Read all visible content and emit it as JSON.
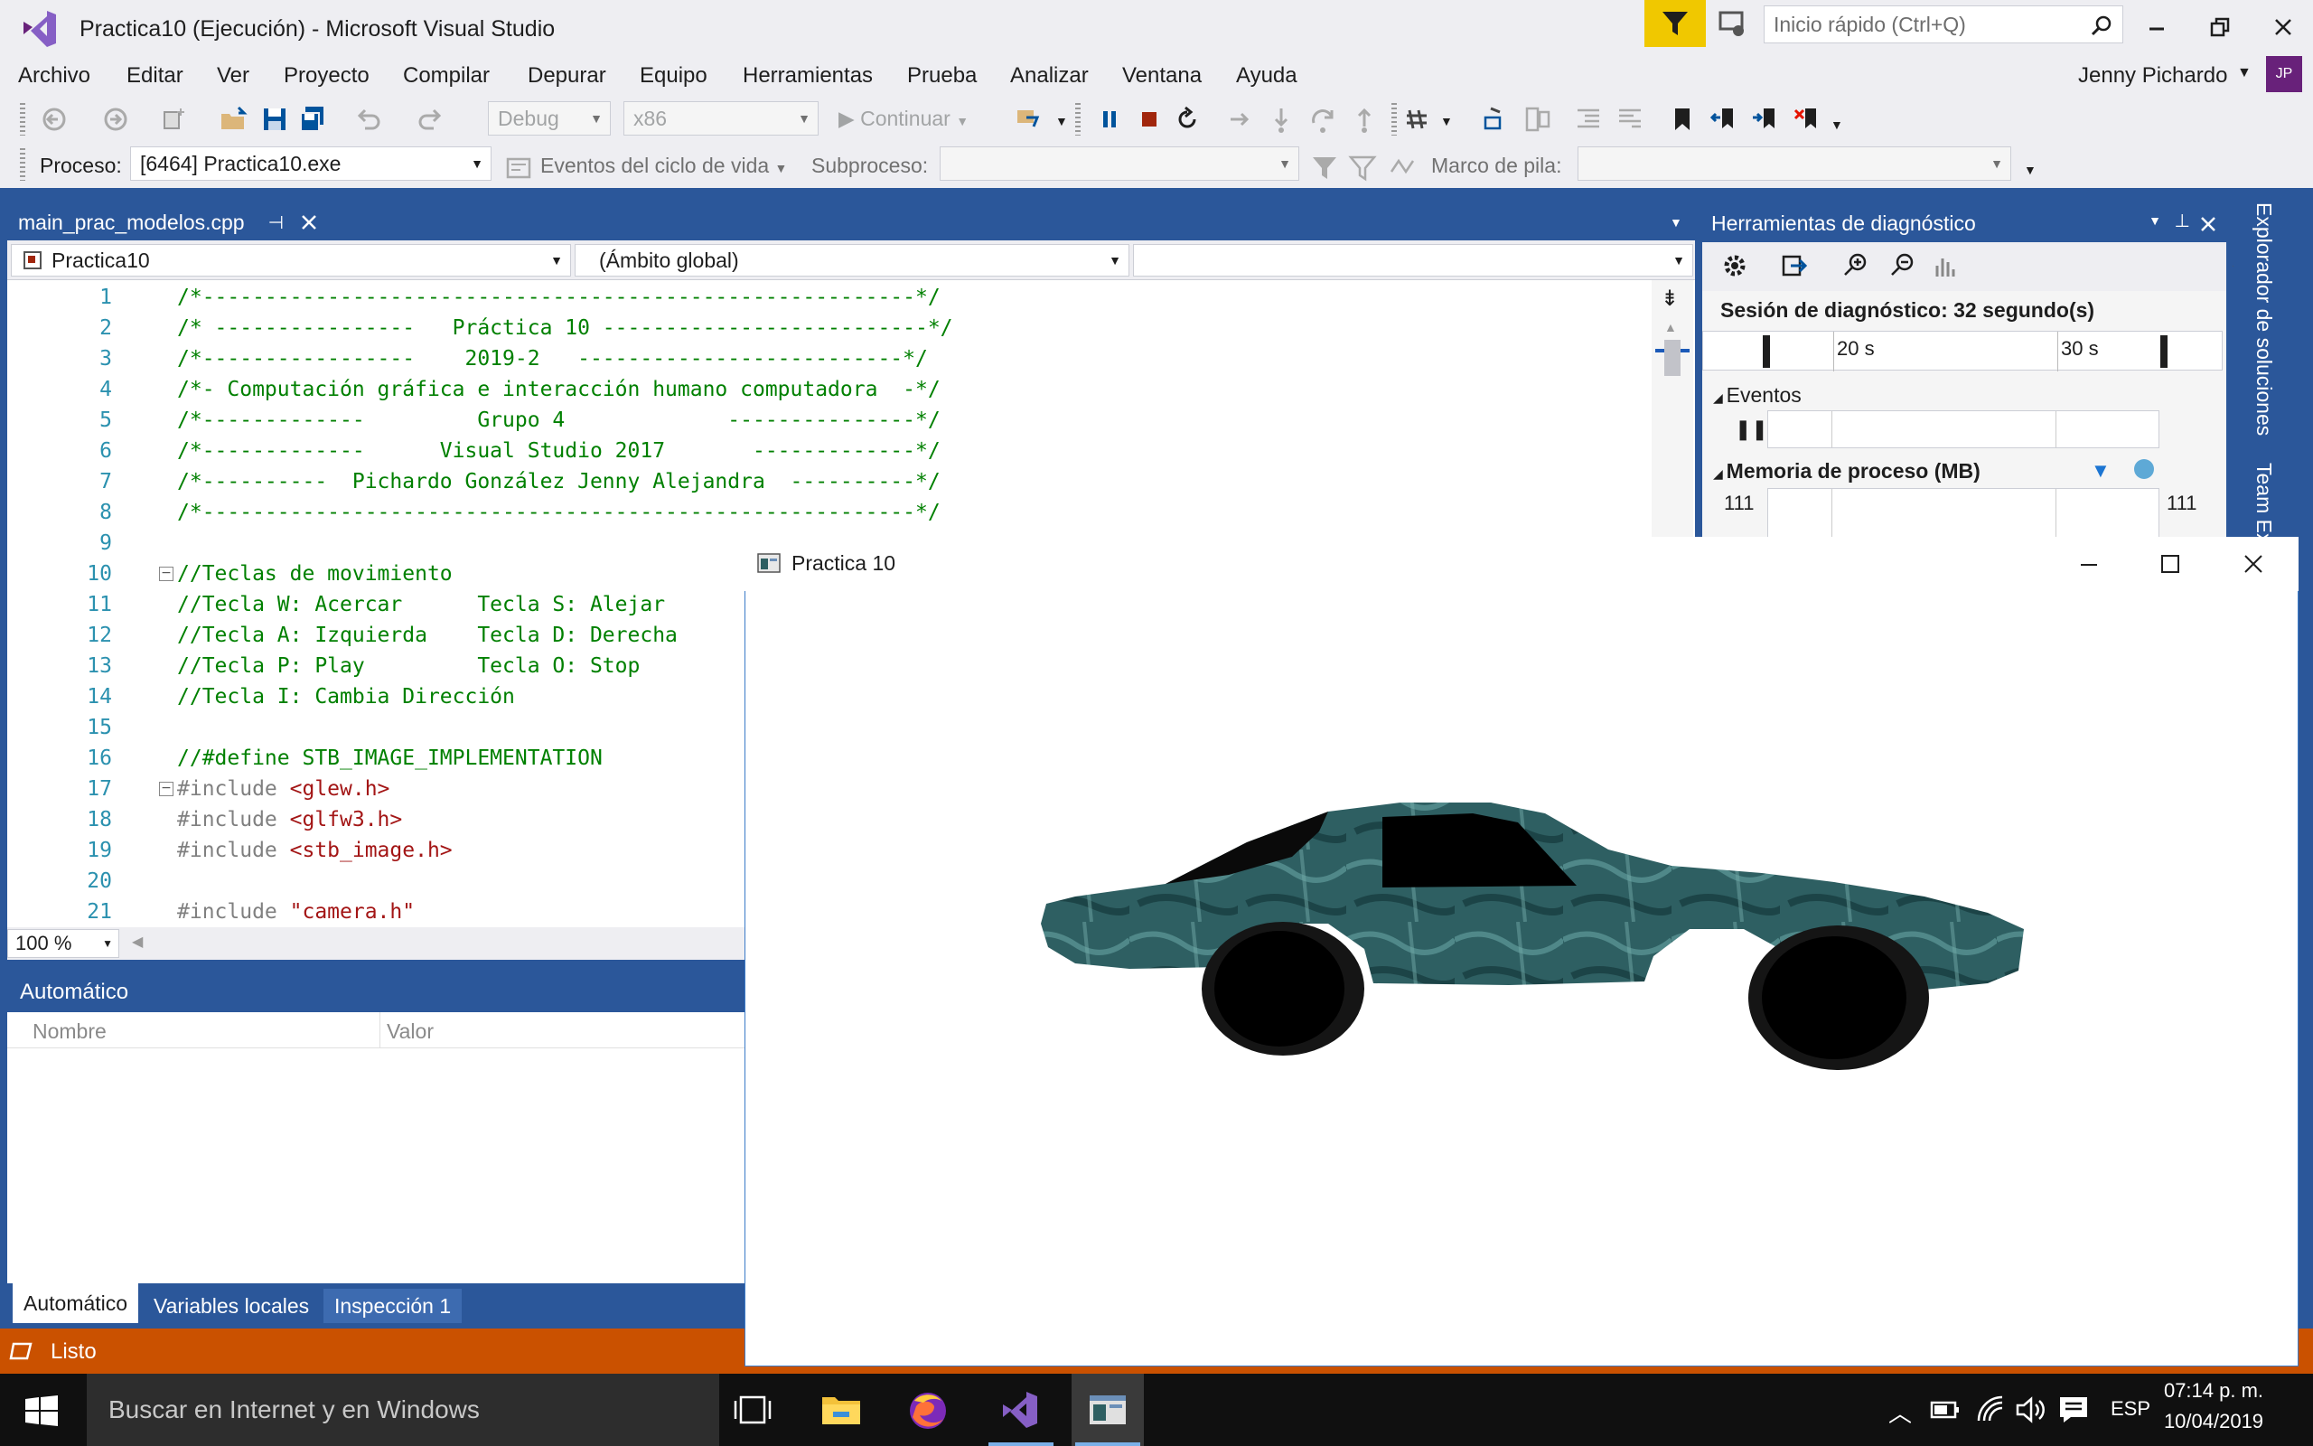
{
  "window": {
    "title": "Practica10 (Ejecución) - Microsoft Visual Studio",
    "quick_launch_placeholder": "Inicio rápido (Ctrl+Q)"
  },
  "menu": [
    "Archivo",
    "Editar",
    "Ver",
    "Proyecto",
    "Compilar",
    "Depurar",
    "Equipo",
    "Herramientas",
    "Prueba",
    "Analizar",
    "Ventana",
    "Ayuda"
  ],
  "user": {
    "name": "Jenny Pichardo",
    "initials": "JP"
  },
  "toolbar": {
    "config": "Debug",
    "platform": "x86",
    "continue": "Continuar"
  },
  "toolbar2": {
    "process_label": "Proceso:",
    "process_value": "[6464] Practica10.exe",
    "lifecycle": "Eventos del ciclo de vida",
    "thread_label": "Subproceso:",
    "stack_label": "Marco de pila:"
  },
  "editor": {
    "tab": "main_prac_modelos.cpp",
    "project": "Practica10",
    "scope": "(Ámbito global)",
    "zoom": "100 %",
    "lines": [
      {
        "n": "1",
        "t": "/*---------------------------------------------------------*/",
        "c": "cm"
      },
      {
        "n": "2",
        "t": "/* ----------------   Práctica 10 --------------------------*/",
        "c": "cm"
      },
      {
        "n": "3",
        "t": "/*-----------------    2019-2   --------------------------*/",
        "c": "cm"
      },
      {
        "n": "4",
        "t": "/*- Computación gráfica e interacción humano computadora  -*/",
        "c": "cm"
      },
      {
        "n": "5",
        "t": "/*-------------         Grupo 4             ---------------*/",
        "c": "cm"
      },
      {
        "n": "6",
        "t": "/*-------------      Visual Studio 2017       -------------*/",
        "c": "cm"
      },
      {
        "n": "7",
        "t": "/*----------  Pichardo González Jenny Alejandra  ----------*/",
        "c": "cm"
      },
      {
        "n": "8",
        "t": "/*---------------------------------------------------------*/",
        "c": "cm"
      },
      {
        "n": "9",
        "t": "",
        "c": ""
      },
      {
        "n": "10",
        "t": "//Teclas de movimiento",
        "c": "cm"
      },
      {
        "n": "11",
        "t": "//Tecla W: Acercar      Tecla S: Alejar",
        "c": "cm"
      },
      {
        "n": "12",
        "t": "//Tecla A: Izquierda    Tecla D: Derecha",
        "c": "cm"
      },
      {
        "n": "13",
        "t": "//Tecla P: Play         Tecla O: Stop",
        "c": "cm"
      },
      {
        "n": "14",
        "t": "//Tecla I: Cambia Dirección",
        "c": "cm"
      },
      {
        "n": "15",
        "t": "",
        "c": ""
      },
      {
        "n": "16",
        "t": "//#define STB_IMAGE_IMPLEMENTATION",
        "c": "cm"
      },
      {
        "n": "17",
        "t": "#include ",
        "c": "pp",
        "s": "<glew.h>"
      },
      {
        "n": "18",
        "t": "#include ",
        "c": "pp",
        "s": "<glfw3.h>"
      },
      {
        "n": "19",
        "t": "#include ",
        "c": "pp",
        "s": "<stb_image.h>"
      },
      {
        "n": "20",
        "t": "",
        "c": ""
      },
      {
        "n": "21",
        "t": "#include ",
        "c": "pp",
        "s": "\"camera.h\""
      }
    ]
  },
  "auto_panel": {
    "title": "Automático",
    "col_name": "Nombre",
    "col_value": "Valor",
    "tabs": [
      "Automático",
      "Variables locales",
      "Inspección 1"
    ]
  },
  "diagnostics": {
    "title": "Herramientas de diagnóstico",
    "session": "Sesión de diagnóstico: 32 segundo(s)",
    "ticks": [
      "20 s",
      "30 s"
    ],
    "events": "Eventos",
    "memory": "Memoria de proceso (MB)",
    "mem_left": "111",
    "mem_right": "111"
  },
  "side_tabs": [
    "Explorador de soluciones",
    "Team Explorer"
  ],
  "status": "Listo",
  "app_window": {
    "title": "Practica 10"
  },
  "taskbar": {
    "search": "Buscar en Internet y en Windows",
    "lang": "ESP",
    "time": "07:14 p. m.",
    "date": "10/04/2019"
  },
  "colors": {
    "vs_blue": "#2b579a",
    "status_orange": "#ca5100",
    "filter_yellow": "#f0c800",
    "car_teal": "#2e5f62"
  }
}
